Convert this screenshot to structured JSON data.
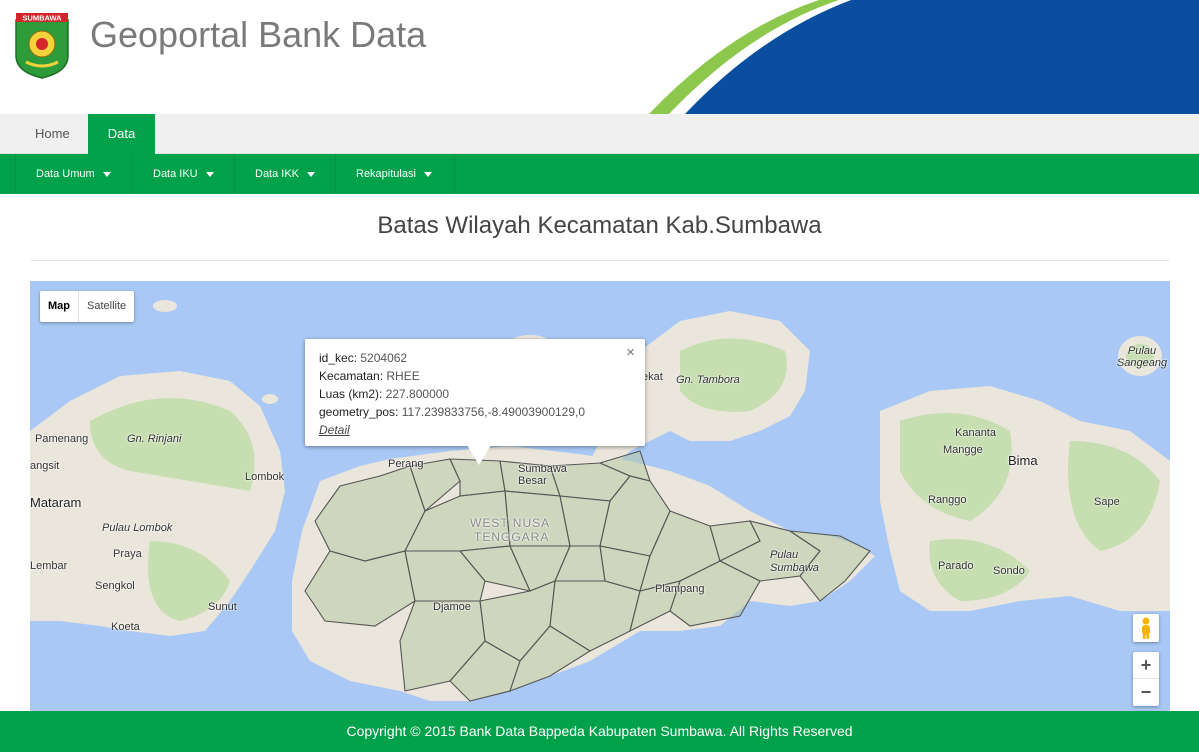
{
  "header": {
    "logo_text": "SUMBAWA",
    "site_title": "Geoportal Bank Data"
  },
  "topnav": {
    "tabs": [
      {
        "label": "Home",
        "active": false
      },
      {
        "label": "Data",
        "active": true
      }
    ]
  },
  "mainmenu": {
    "items": [
      {
        "label": "Data Umum"
      },
      {
        "label": "Data IKU"
      },
      {
        "label": "Data IKK"
      },
      {
        "label": "Rekapitulasi"
      }
    ]
  },
  "page": {
    "title": "Batas Wilayah Kecamatan Kab.Sumbawa"
  },
  "map": {
    "type_controls": {
      "map": "Map",
      "satellite": "Satellite",
      "selected": "Map"
    },
    "labels": {
      "pamenang": "Pamenang",
      "rinjani": "Gn. Rinjani",
      "angsit": "angsit",
      "lombok": "Lombok",
      "mataram": "Mataram",
      "pulau_lombok": "Pulau Lombok",
      "praya": "Praya",
      "lembar": "Lembar",
      "sengkol": "Sengkol",
      "sunut": "Sunut",
      "koeta": "Koeta",
      "perang": "Perang",
      "sumbawa_besar": "Sumbawa Besar",
      "west_nusa_tenggara_1": "WEST NUSA",
      "west_nusa_tenggara_2": "TENGGARA",
      "djamoe": "Djamoe",
      "plampang": "Plampang",
      "pulau_sumbawa": "Pulau Sumbawa",
      "ekat": "ekat",
      "tambora": "Gn. Tambora",
      "pulau_sangeang": "Pulau Sangeang",
      "kananta": "Kananta",
      "mangge": "Mangge",
      "bima": "Bima",
      "ranggo": "Ranggo",
      "sape": "Sape",
      "parado": "Parado",
      "sondo": "Sondo"
    },
    "popup": {
      "fields": [
        {
          "key": "id_kec:",
          "value": "5204062"
        },
        {
          "key": "Kecamatan:",
          "value": "RHEE"
        },
        {
          "key": "Luas (km2):",
          "value": "227.800000"
        },
        {
          "key": "geometry_pos:",
          "value": "117.239833756,-8.49003900129,0"
        }
      ],
      "link": "Detail",
      "close": "×"
    },
    "zoom": {
      "in": "+",
      "out": "−"
    },
    "colors": {
      "water": "#a9c8f5",
      "land": "#eae6dc",
      "green": "#c6deb0",
      "district_fill": "#b8c9a6",
      "district_stroke": "#555555"
    }
  },
  "footer": {
    "text": "Copyright © 2015 Bank Data Bappeda Kabupaten Sumbawa. All Rights Reserved"
  }
}
